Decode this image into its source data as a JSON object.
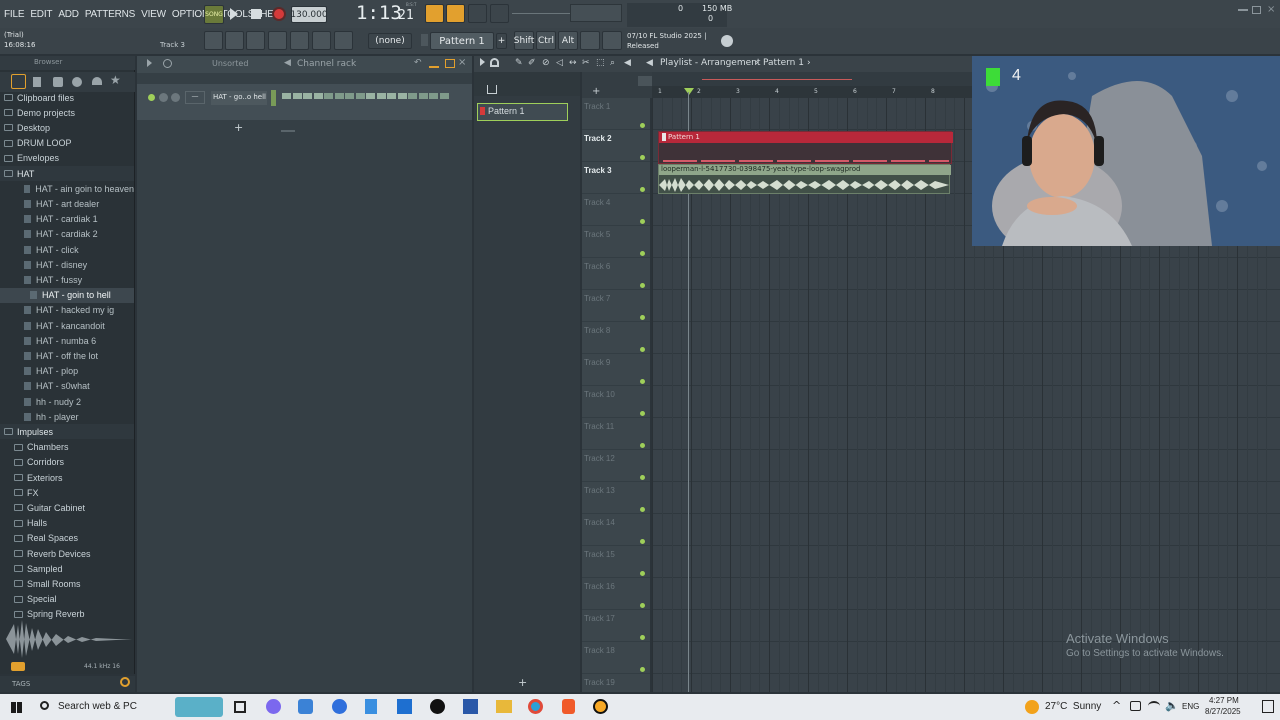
{
  "menu": [
    "FILE",
    "EDIT",
    "ADD",
    "PATTERNS",
    "VIEW",
    "OPTIONS",
    "TOOLS",
    "HELP"
  ],
  "transport": {
    "mode": "SONG",
    "tempo": "130.000",
    "time_main": "1:13",
    "time_sub": "21",
    "time_label": "B:S:T"
  },
  "cpu": {
    "mem": "150 MB",
    "cpu_val": "0",
    "cpu2": "0"
  },
  "hint": {
    "title": "(Trial)",
    "time": "16:08:16",
    "track": "Track 3"
  },
  "snap": "(none)",
  "pattern_selector": "Pattern 1",
  "keys": [
    "Shift",
    "Ctrl",
    "Alt"
  ],
  "news": {
    "line1": "07/10 FL Studio 2025 |",
    "line2": "Released"
  },
  "browser": {
    "title": "Browser",
    "items": [
      {
        "label": "Clipboard files",
        "kind": "folder"
      },
      {
        "label": "Demo projects",
        "kind": "folder"
      },
      {
        "label": "Desktop",
        "kind": "folder"
      },
      {
        "label": "DRUM LOOP",
        "kind": "folder"
      },
      {
        "label": "Envelopes",
        "kind": "folder"
      },
      {
        "label": "HAT",
        "kind": "folder-open"
      },
      {
        "label": "HAT - ain goin to heaven",
        "kind": "file"
      },
      {
        "label": "HAT - art dealer",
        "kind": "file"
      },
      {
        "label": "HAT - cardiak 1",
        "kind": "file"
      },
      {
        "label": "HAT - cardiak 2",
        "kind": "file"
      },
      {
        "label": "HAT - click",
        "kind": "file"
      },
      {
        "label": "HAT - disney",
        "kind": "file"
      },
      {
        "label": "HAT - fussy",
        "kind": "file"
      },
      {
        "label": "HAT - goin to hell",
        "kind": "file-selected"
      },
      {
        "label": "HAT - hacked my ig",
        "kind": "file"
      },
      {
        "label": "HAT - kancandoit",
        "kind": "file"
      },
      {
        "label": "HAT - numba 6",
        "kind": "file"
      },
      {
        "label": "HAT - off the lot",
        "kind": "file"
      },
      {
        "label": "HAT - plop",
        "kind": "file"
      },
      {
        "label": "HAT - s0what",
        "kind": "file"
      },
      {
        "label": "hh - nudy 2",
        "kind": "file"
      },
      {
        "label": "hh - player",
        "kind": "file"
      },
      {
        "label": "Impulses",
        "kind": "folder-open"
      },
      {
        "label": "Chambers",
        "kind": "subfolder"
      },
      {
        "label": "Corridors",
        "kind": "subfolder"
      },
      {
        "label": "Exteriors",
        "kind": "subfolder"
      },
      {
        "label": "FX",
        "kind": "subfolder"
      },
      {
        "label": "Guitar Cabinet",
        "kind": "subfolder"
      },
      {
        "label": "Halls",
        "kind": "subfolder"
      },
      {
        "label": "Real Spaces",
        "kind": "subfolder"
      },
      {
        "label": "Reverb Devices",
        "kind": "subfolder"
      },
      {
        "label": "Sampled",
        "kind": "subfolder"
      },
      {
        "label": "Small Rooms",
        "kind": "subfolder"
      },
      {
        "label": "Special",
        "kind": "subfolder"
      },
      {
        "label": "Spring Reverb",
        "kind": "subfolder"
      }
    ],
    "sample_info": "44.1 kHz 16",
    "tags": "TAGS"
  },
  "channel_rack": {
    "filter": "Unsorted",
    "title": "Channel rack",
    "channel_name": "HAT - go..o hell",
    "add": "+"
  },
  "picker": {
    "pattern": "Pattern 1",
    "add": "+"
  },
  "playlist": {
    "title": "Playlist - Arrangement",
    "pattern": "Pattern 1",
    "ruler": [
      "1",
      "2",
      "3",
      "4",
      "5",
      "6",
      "7",
      "8"
    ],
    "tracks": [
      "Track 1",
      "Track 2",
      "Track 3",
      "Track 4",
      "Track 5",
      "Track 6",
      "Track 7",
      "Track 8",
      "Track 9",
      "Track 10",
      "Track 11",
      "Track 12",
      "Track 13",
      "Track 14",
      "Track 15",
      "Track 16",
      "Track 17",
      "Track 18",
      "Track 19"
    ],
    "clip_pattern": "Pattern 1",
    "clip_audio": "looperman-l-5417730-0398475-yeat-type-loop-swagprod"
  },
  "watermark": {
    "title": "Activate Windows",
    "sub": "Go to Settings to activate Windows."
  },
  "webcam": {
    "badge": "4"
  },
  "taskbar": {
    "search": "Search web & PC",
    "weather": "27°C  Sunny",
    "lang": "ENG",
    "time": "4:27 PM",
    "date": "8/27/2025"
  },
  "colors": {
    "accent_green": "#9fcf5a",
    "pattern_red": "#b8283a",
    "audio_clip": "#8fa68a",
    "selected_pattern": "#5c7a4e"
  }
}
